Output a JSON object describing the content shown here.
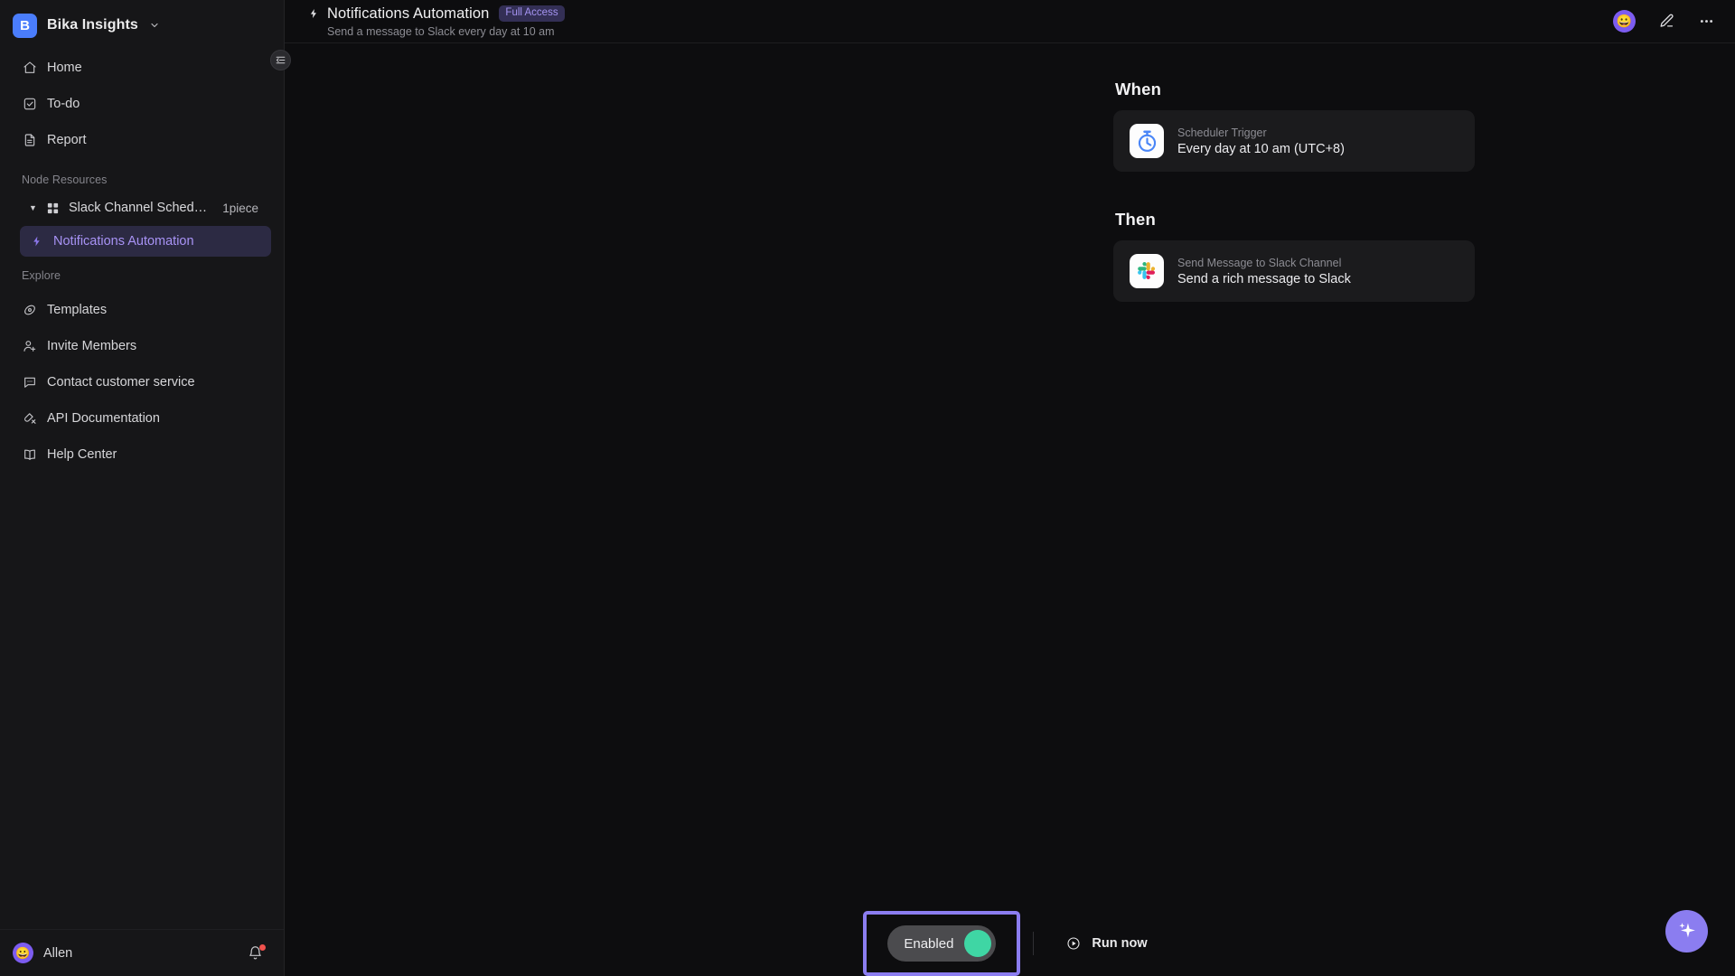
{
  "workspace": {
    "logo_letter": "B",
    "name": "Bika Insights",
    "caret_icon": "chevron-down-icon",
    "logo_color": "#4a7dfc"
  },
  "sidebar": {
    "nav": [
      {
        "label": "Home",
        "icon": "home-icon"
      },
      {
        "label": "To-do",
        "icon": "checkbox-icon"
      },
      {
        "label": "Report",
        "icon": "document-icon"
      }
    ],
    "node_resources_label": "Node Resources",
    "tree": {
      "name": "Slack Channel Scheduled ...",
      "count": "1piece",
      "expand_icon": "triangle-down-icon",
      "node_icon": "grid-icon",
      "child": {
        "label": "Notifications Automation",
        "icon": "bolt-icon",
        "active": true,
        "active_bg": "#2c2a43",
        "active_text": "#a893f5"
      }
    },
    "explore_label": "Explore",
    "explore": [
      {
        "label": "Templates",
        "icon": "template-icon"
      },
      {
        "label": "Invite Members",
        "icon": "user-plus-icon"
      },
      {
        "label": "Contact customer service",
        "icon": "chat-icon"
      },
      {
        "label": "API Documentation",
        "icon": "api-icon"
      },
      {
        "label": "Help Center",
        "icon": "book-icon"
      }
    ],
    "user": {
      "name": "Allen",
      "avatar_emoji": "😀",
      "bell_icon": "bell-icon",
      "has_notification": true
    },
    "collapse_icon": "collapse-sidebar-icon"
  },
  "header": {
    "bolt_icon": "bolt-icon",
    "title": "Notifications Automation",
    "badge": "Full Access",
    "subtitle": "Send a message to Slack every day at 10 am",
    "avatar_emoji": "😀",
    "edit_icon": "pencil-icon",
    "more_icon": "more-horizontal-icon"
  },
  "flow": {
    "when": {
      "heading": "When",
      "card": {
        "icon": "stopwatch-icon",
        "kind": "Scheduler Trigger",
        "description": "Every day at 10 am (UTC+8)"
      }
    },
    "then": {
      "heading": "Then",
      "card": {
        "icon": "slack-icon",
        "kind": "Send Message to Slack Channel",
        "description": "Send a rich message to Slack"
      }
    }
  },
  "actionbar": {
    "toggle": {
      "label": "Enabled",
      "state": "on",
      "knob_color": "#3fd6a4",
      "focus_outline_color": "#8b7df0"
    },
    "run_now": {
      "label": "Run now",
      "icon": "play-circle-icon"
    }
  },
  "fab": {
    "icon": "sparkle-icon",
    "color": "#8b7df0"
  }
}
